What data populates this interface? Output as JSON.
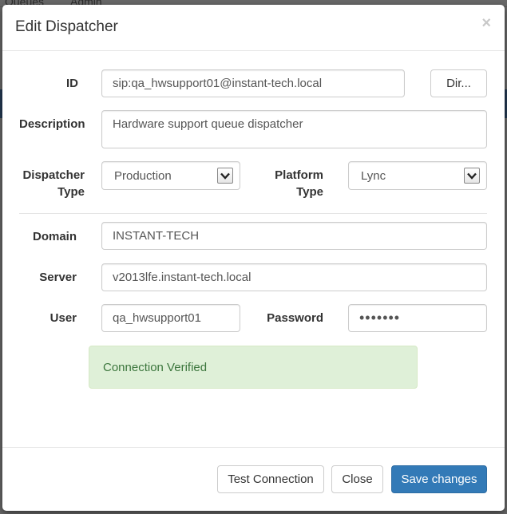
{
  "background": {
    "tabs": [
      "Queues",
      "Admin"
    ]
  },
  "dialog": {
    "title": "Edit Dispatcher",
    "close_glyph": "×"
  },
  "form": {
    "id": {
      "label": "ID",
      "value": "sip:qa_hwsupport01@instant-tech.local",
      "button": "Dir..."
    },
    "description": {
      "label": "Description",
      "value": "Hardware support queue dispatcher"
    },
    "dispatcher_type": {
      "label_line1": "Dispatcher",
      "label_line2": "Type",
      "selected": "Production"
    },
    "platform_type": {
      "label_line1": "Platform",
      "label_line2": "Type",
      "selected": "Lync"
    },
    "domain": {
      "label": "Domain",
      "value": "INSTANT-TECH"
    },
    "server": {
      "label": "Server",
      "value": "v2013lfe.instant-tech.local"
    },
    "user": {
      "label": "User",
      "value": "qa_hwsupport01"
    },
    "password": {
      "label": "Password",
      "value": "1234567"
    }
  },
  "alert": {
    "text": "Connection Verified",
    "status": "success",
    "color": "#3c763d"
  },
  "footer": {
    "test_connection": "Test Connection",
    "close": "Close",
    "save": "Save changes"
  },
  "colors": {
    "primary": "#337ab7",
    "success_bg": "#dff0d8"
  },
  "icons": {
    "select_arrow": "chevron-down-icon",
    "close": "close-icon"
  }
}
